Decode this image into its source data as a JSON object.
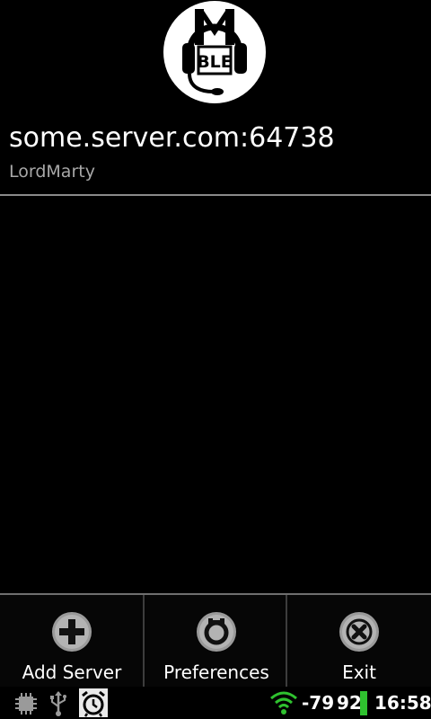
{
  "logo": {
    "text": "BLE",
    "icon": "mumble-headset-logo"
  },
  "server": {
    "host": "some.server.com:64738",
    "user": "LordMarty"
  },
  "menu": {
    "items": [
      {
        "label": "Add Server",
        "icon": "add-icon"
      },
      {
        "label": "Preferences",
        "icon": "gear-icon"
      },
      {
        "label": "Exit",
        "icon": "close-icon"
      }
    ]
  },
  "status_bar": {
    "signal_dbm": "-79",
    "battery_level": "92",
    "time": "16:58",
    "left_icons": [
      "chip-icon",
      "usb-icon",
      "alarm-icon"
    ],
    "battery_color": "#2fc22f"
  }
}
